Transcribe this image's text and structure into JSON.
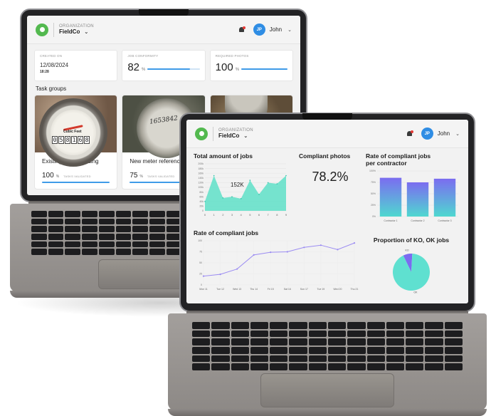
{
  "left_app": {
    "header": {
      "org_label": "ORGANIZATION",
      "org_name": "FieldCo",
      "user_initials": "JP",
      "user_name": "John"
    },
    "stats": {
      "created_on": {
        "label": "CREATED ON",
        "date": "12/08/2024",
        "time": "18:28"
      },
      "job_conformity": {
        "label": "JOB CONFORMITY",
        "value": "82",
        "unit": "%",
        "progress": 0.82
      },
      "required_photos": {
        "label": "REQUIRED PHOTOS",
        "value": "100",
        "unit": "%",
        "progress": 1.0
      }
    },
    "task_groups_title": "Task groups",
    "task_groups": [
      {
        "name": "Existing meter reading",
        "value": "100",
        "unit": "%",
        "status": "TASKS VALIDATED",
        "meter_digits": [
          "0",
          "5",
          "8",
          "1",
          "6",
          "8"
        ],
        "meter_unit": "Cubic Feet"
      },
      {
        "name": "New meter reference",
        "value": "75",
        "unit": "%",
        "status": "TASKS VALIDATED",
        "handwritten": "1653842"
      },
      {
        "name": "",
        "value": "",
        "unit": "",
        "status": ""
      }
    ]
  },
  "right_app": {
    "header": {
      "org_label": "ORGANIZATION",
      "org_name": "FieldCo",
      "user_initials": "JP",
      "user_name": "John"
    },
    "panels": {
      "total_jobs_title": "Total amount of jobs",
      "total_jobs_annotation": "152K",
      "compliant_photos_title": "Compliant photos",
      "compliant_photos_value": "78.2%",
      "contractor_rate_title_line1": "Rate of compliant jobs",
      "contractor_rate_title_line2": "per contractor",
      "compliant_rate_title": "Rate of compliant jobs",
      "proportion_title": "Proportion of KO, OK jobs"
    }
  },
  "colors": {
    "accent_blue": "#3f9be8",
    "logo_green": "#53b94f",
    "area_teal": "#5fe0c8",
    "line_purple": "#9b8cf2",
    "bar_top": "#7b6cf0",
    "bar_bottom": "#4fd8d0",
    "pie_ok": "#5fe0d0",
    "pie_ko": "#7b6cf0"
  },
  "chart_data": [
    {
      "id": "total_jobs",
      "type": "area",
      "title": "Total amount of jobs",
      "x": [
        "0",
        "1",
        "2",
        "3",
        "4",
        "5",
        "6",
        "7",
        "8",
        "9"
      ],
      "y_ticks": [
        "0",
        "20k",
        "40k",
        "60k",
        "80k",
        "100k",
        "120k",
        "140k",
        "160k",
        "180k",
        "200k"
      ],
      "ylim": [
        0,
        200
      ],
      "values": [
        40,
        150,
        55,
        60,
        52,
        130,
        70,
        120,
        115,
        150
      ],
      "annotation": "152K"
    },
    {
      "id": "contractor_rate",
      "type": "bar",
      "title": "Rate of compliant jobs per contractor",
      "categories": [
        "Contractor 1",
        "Contractor 2",
        "Contractor 3"
      ],
      "values": [
        85,
        75,
        83
      ],
      "y_ticks": [
        "0%",
        "25%",
        "50%",
        "75%",
        "100%"
      ],
      "ylim": [
        0,
        100
      ]
    },
    {
      "id": "compliant_rate",
      "type": "line",
      "title": "Rate of compliant jobs",
      "x": [
        "Mon 11",
        "Tue 12",
        "Wed 13",
        "Thu 14",
        "Fri 15",
        "Sat 16",
        "Sun 17",
        "Tue 19",
        "Wed 20",
        "Thu 21"
      ],
      "values": [
        20,
        24,
        36,
        68,
        74,
        75,
        85,
        90,
        80,
        95
      ],
      "y_ticks": [
        "0",
        "25",
        "50",
        "75",
        "100"
      ],
      "ylim": [
        0,
        100
      ]
    },
    {
      "id": "ko_ok",
      "type": "pie",
      "title": "Proportion of KO, OK jobs",
      "labels": [
        "KO",
        "OK"
      ],
      "values": [
        8,
        92
      ]
    }
  ]
}
